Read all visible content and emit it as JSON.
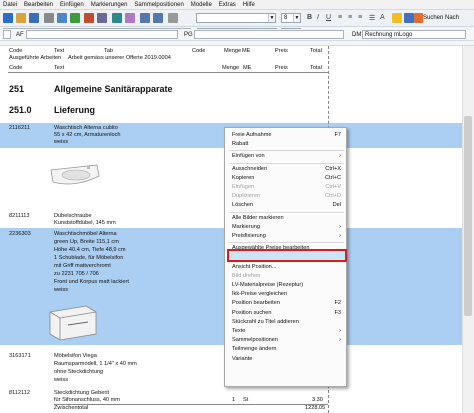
{
  "menubar": [
    "Datei",
    "Bearbeiten",
    "Einfügen",
    "Markierungen",
    "Sammelpositionen",
    "Modelle",
    "Extras",
    "Hilfe"
  ],
  "toolbar": {
    "font_size_value": "8",
    "search_label": "Suchen Nach"
  },
  "editbar": {
    "af_label": "AF",
    "pg_label": "PG",
    "dm_label": "DM",
    "dm_value": "Rechnung mLogo"
  },
  "columns_top": {
    "code": "Code",
    "text": "Text",
    "tab": "Tab",
    "code2": "Code",
    "menge": "Menge",
    "me": "ME",
    "preis": "Preis",
    "total": "Total"
  },
  "header_line": {
    "left": "Ausgeführte Arbeiten",
    "right": "Arbeit gemäss unserer Offerte 2019.0004"
  },
  "columns": {
    "code": "Code",
    "text": "Text",
    "menge": "Menge",
    "me": "ME",
    "preis": "Preis",
    "total": "Total"
  },
  "groups": [
    {
      "code": "251",
      "title": "Allgemeine Sanitärapparate"
    },
    {
      "code": "251.0",
      "title": "Lieferung"
    }
  ],
  "items": [
    {
      "code": "2116211",
      "lines": [
        "Waschtisch Alterna cubito",
        "55 x 42 cm, Armaturenloch",
        "weiss"
      ]
    },
    {
      "code": "8211113",
      "lines": [
        "Dübelschraube",
        "Kunststoffdübel, 145 mm"
      ]
    },
    {
      "code": "2236303",
      "lines": [
        "Waschtischmöbel Alterna",
        "green Up, Breite 115,1 cm",
        "Höhe 40,4 cm, Tiefe 48,9 cm",
        "1 Schublade, für Möbelsifon",
        "mit Griff mattverchromt",
        "zu 2231 705 / 706",
        "Front und Korpus matt lackiert",
        "weiss"
      ]
    },
    {
      "code": "3163171",
      "lines": [
        "Möbelsifon Viega",
        "Raumsparmodell, 1 1/4\" x 40 mm",
        "ohne Steckdichtung",
        "weiss"
      ]
    },
    {
      "code": "8112112",
      "lines": [
        "Steckdichtung Geberit",
        "für Sifonanschluss, 40 mm"
      ]
    }
  ],
  "last_item": {
    "menge": "1",
    "me": "St",
    "total": "3.30"
  },
  "subtotal": {
    "label": "Zwischentotal",
    "total": "1228.05"
  },
  "context_menu": [
    {
      "label": "Freie Aufnahme",
      "shortcut": "F7",
      "disabled": false
    },
    {
      "label": "Rabatt",
      "shortcut": "",
      "disabled": false
    },
    {
      "sep": true
    },
    {
      "label": "Einfügen von",
      "shortcut": "›",
      "disabled": false
    },
    {
      "sep": true
    },
    {
      "label": "Ausschneiden",
      "shortcut": "Ctrl+X",
      "disabled": false
    },
    {
      "label": "Kopieren",
      "shortcut": "Ctrl+C",
      "disabled": false
    },
    {
      "label": "Einfügen",
      "shortcut": "Ctrl+V",
      "disabled": true
    },
    {
      "label": "Duplizieren",
      "shortcut": "Ctrl+D",
      "disabled": true
    },
    {
      "label": "Löschen",
      "shortcut": "Del",
      "disabled": false
    },
    {
      "sep": true
    },
    {
      "label": "Alle Bilder markieren",
      "shortcut": "",
      "disabled": false
    },
    {
      "label": "Markierung",
      "shortcut": "›",
      "disabled": false
    },
    {
      "label": "Preisfixierung",
      "shortcut": "›",
      "disabled": false
    },
    {
      "sep": true
    },
    {
      "label": "Ausgewählte Preise bearbeiten",
      "shortcut": "",
      "disabled": false,
      "highlighted": true
    },
    {
      "label": "als Standard AF/PG setzen",
      "shortcut": "",
      "disabled": false
    },
    {
      "label": "Ansicht Position...",
      "shortcut": "",
      "disabled": false
    },
    {
      "label": "Bild drehen",
      "shortcut": "",
      "disabled": true
    },
    {
      "label": "LV-Materialpreise (Rezeptur)",
      "shortcut": "",
      "disabled": false
    },
    {
      "label": "Ikk-Preise vergleichen",
      "shortcut": "",
      "disabled": false
    },
    {
      "label": "Position bearbeiten",
      "shortcut": "F2",
      "disabled": false
    },
    {
      "label": "Position suchen",
      "shortcut": "F3",
      "disabled": false
    },
    {
      "label": "Stückzahl zu Titel addieren",
      "shortcut": "",
      "disabled": false
    },
    {
      "label": "Texte",
      "shortcut": "›",
      "disabled": false
    },
    {
      "label": "Sammelpositionen",
      "shortcut": "›",
      "disabled": false
    },
    {
      "label": "Teilmenge ändern",
      "shortcut": "",
      "disabled": false
    },
    {
      "label": "Variante",
      "shortcut": "",
      "disabled": false
    }
  ],
  "colors": {
    "selection": "#aacff3",
    "highlight_border": "#d41f1f"
  }
}
